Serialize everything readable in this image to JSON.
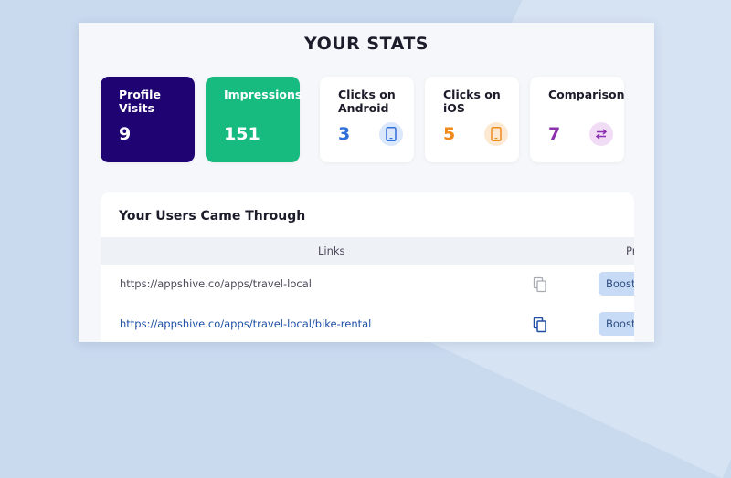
{
  "page": {
    "title": "YOUR STATS"
  },
  "stats": [
    {
      "label": "Profile Visits",
      "value": "9"
    },
    {
      "label": "Impressions",
      "value": "151"
    },
    {
      "label": "Clicks on Android",
      "value": "3",
      "icon": "smartphone-icon",
      "color": "#2f6fd8"
    },
    {
      "label": "Clicks on iOS",
      "value": "5",
      "icon": "smartphone-icon",
      "color": "#f08a1c"
    },
    {
      "label": "Comparison",
      "value": "7",
      "icon": "swap-arrows-icon",
      "color": "#8c2fb0"
    }
  ],
  "users": {
    "title": "Your Users Came Through",
    "columns": {
      "links": "Links",
      "second": "Pr"
    },
    "rows": [
      {
        "link": "https://appshive.co/apps/travel-local",
        "action": "Boost"
      },
      {
        "link": "https://appshive.co/apps/travel-local/bike-rental",
        "action": "Boost"
      }
    ]
  }
}
